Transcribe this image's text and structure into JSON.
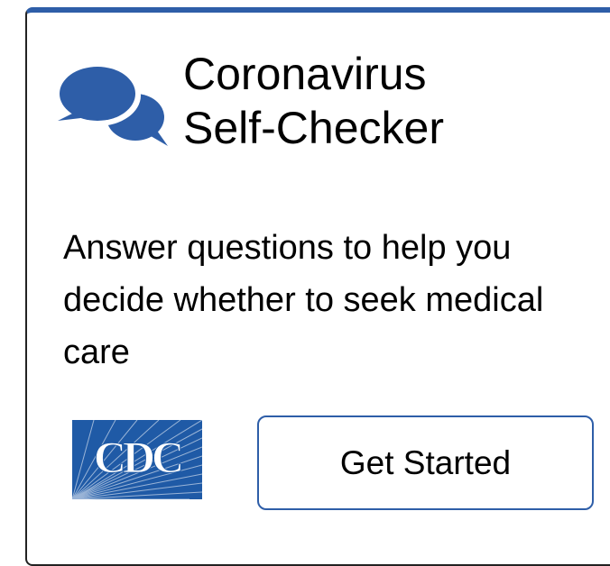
{
  "widget": {
    "title_line1": "Coronavirus",
    "title_line2": "Self-Checker",
    "description": "Answer questions to help you decide whether to seek medical care",
    "button_label": "Get Started",
    "logo_text": "CDC",
    "icon": "speech-bubbles-icon"
  },
  "colors": {
    "accent": "#2e5ea8",
    "logo_blue": "#1f5aa6",
    "text": "#000000"
  }
}
